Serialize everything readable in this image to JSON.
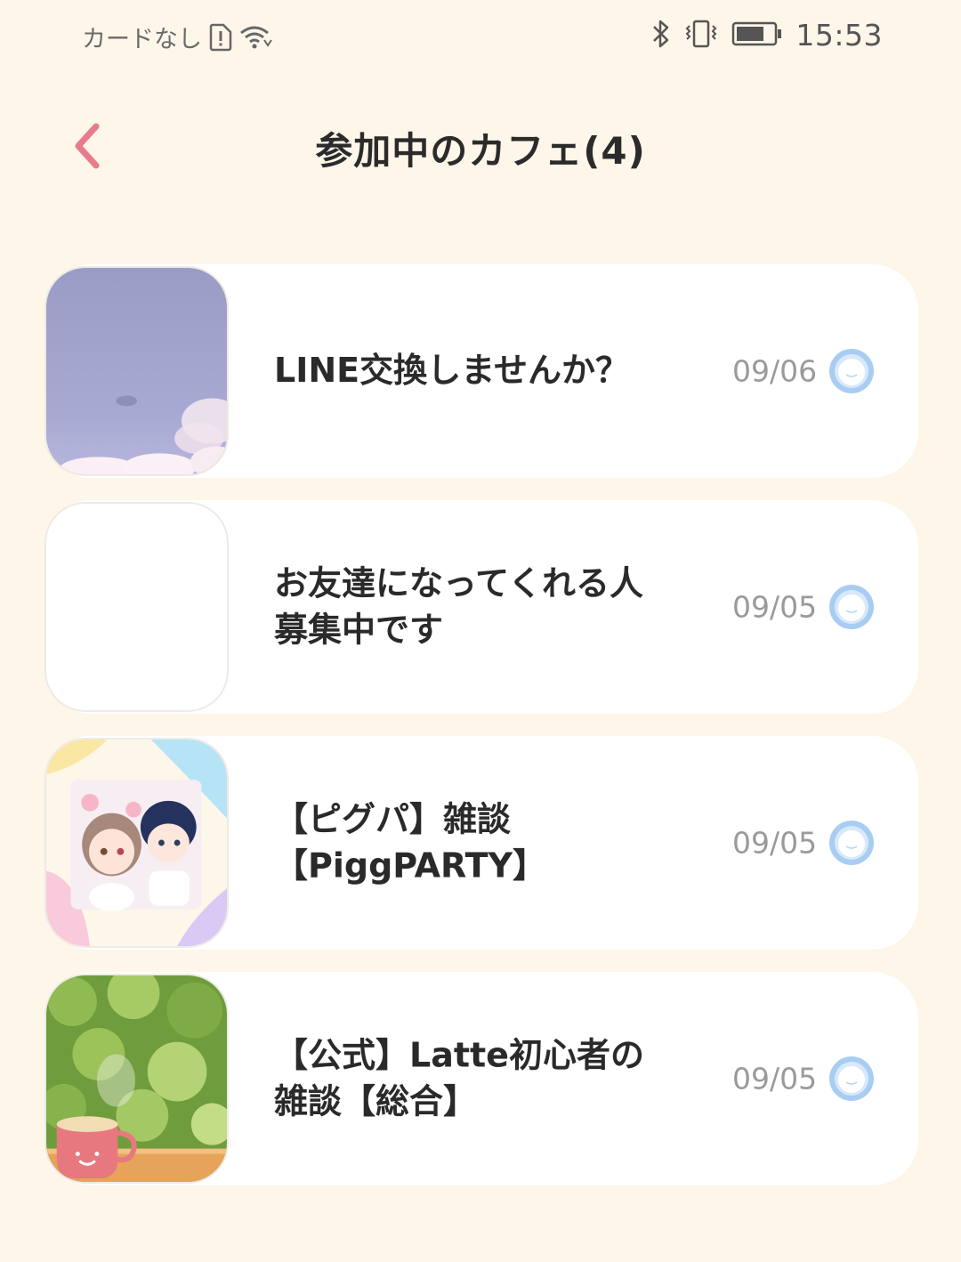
{
  "status_bar": {
    "carrier": "カードなし",
    "time": "15:53",
    "icons": [
      "sim-alert-icon",
      "wifi-icon",
      "bluetooth-icon",
      "vibrate-icon",
      "battery-icon"
    ]
  },
  "header": {
    "back_icon": "chevron-left-icon",
    "title": "参加中のカフェ(4)"
  },
  "colors": {
    "background": "#fdf6e9",
    "card": "#ffffff",
    "accent_pink": "#e97a8c",
    "read_indicator": "#a9cdf2"
  },
  "cafes": [
    {
      "name": "LINE交換しませんか？",
      "date": "09/06",
      "thumb": "purple-sky-image"
    },
    {
      "name": "お友達になってくれる人\n募集中です",
      "date": "09/05",
      "thumb": "blank-image"
    },
    {
      "name": "【ピグパ】雑談\n【PiggPARTY】",
      "date": "09/05",
      "thumb": "pigg-party-avatars-image"
    },
    {
      "name": "【公式】Latte初心者の\n雑談【総合】",
      "date": "09/05",
      "thumb": "latte-cup-greenery-image"
    }
  ]
}
